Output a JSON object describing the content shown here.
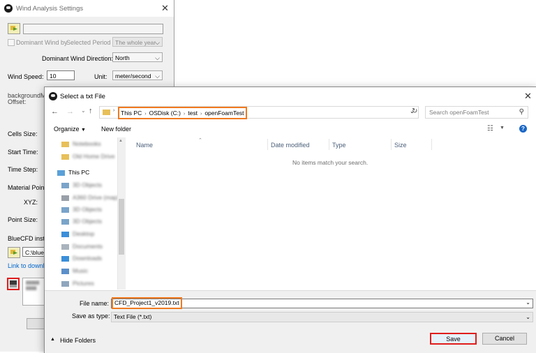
{
  "wind": {
    "title": "Wind Analysis Settings",
    "dominant_wind_label": "Dominant Wind by",
    "selected_period_label": "Selected Period",
    "period_value": "The whole year",
    "direction_label": "Dominant Wind Direction:",
    "direction_value": "North",
    "speed_label": "Wind Speed:",
    "speed_value": "10",
    "unit_label": "Unit:",
    "unit_value": "meter/second",
    "background_label": "backgroundMe",
    "offset_label": "Offset:",
    "cells_label": "Cells Size:",
    "start_label": "Start Time:",
    "step_label": "Time Step:",
    "material_label": "Material Point",
    "xyz_label": "XYZ:",
    "point_size_label": "Point Size:",
    "bluecfd_label": "BlueCFD insta",
    "bluecfd_path": "C:\\blueC",
    "download_link": "Link to downlo"
  },
  "file": {
    "title": "Select a txt File",
    "breadcrumb": [
      "This PC",
      "OSDisk (C:)",
      "test",
      "openFoamTest"
    ],
    "search_placeholder": "Search openFoamTest",
    "organize": "Organize",
    "new_folder": "New folder",
    "sidebar": {
      "top_items": [
        "Notebooks",
        "Old Home Drive"
      ],
      "this_pc": "This PC",
      "pc_items": [
        "3D Objects",
        "A360 Drive (map)",
        "3D Objects",
        "3D Objects",
        "Desktop",
        "Documents",
        "Downloads",
        "Music",
        "Pictures"
      ]
    },
    "columns": [
      "Name",
      "Date modified",
      "Type",
      "Size"
    ],
    "empty_message": "No items match your search.",
    "file_name_label": "File name:",
    "file_name_value": "CFD_Project1_v2019.txt",
    "save_type_label": "Save as type:",
    "save_type_value": "Text File (*.txt)",
    "hide_folders": "Hide Folders",
    "save_button": "Save",
    "cancel_button": "Cancel"
  },
  "colors": {
    "highlight_orange": "#f07a1f",
    "highlight_red": "#e01d1d",
    "link_blue": "#0066cc"
  }
}
